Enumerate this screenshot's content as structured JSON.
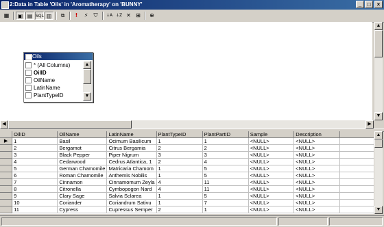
{
  "window": {
    "title": "2:Data in Table 'Oils' in 'Aromatherapy' on 'BUNNY'",
    "controls": [
      "_",
      "□",
      "×"
    ]
  },
  "toolbar": {
    "buttons": [
      {
        "name": "new-query-icon",
        "glyph": "▦"
      },
      {
        "name": "show-diagram-pane-icon",
        "glyph": "▣"
      },
      {
        "name": "show-grid-pane-icon",
        "glyph": "▤"
      },
      {
        "name": "show-sql-pane-icon",
        "glyph": "SQL"
      },
      {
        "name": "show-results-pane-icon",
        "glyph": "▥"
      },
      {
        "name": "change-query-type-icon",
        "glyph": "⧉"
      },
      {
        "name": "run-icon",
        "glyph": "!"
      },
      {
        "name": "verify-sql-icon",
        "glyph": "⚡"
      },
      {
        "name": "filter-icon",
        "glyph": "⛉"
      },
      {
        "name": "sort-ascending-icon",
        "glyph": "↓A"
      },
      {
        "name": "sort-descending-icon",
        "glyph": "↓Z"
      },
      {
        "name": "remove-filter-icon",
        "glyph": "✕"
      },
      {
        "name": "group-by-icon",
        "glyph": "⊞"
      },
      {
        "name": "add-table-icon",
        "glyph": "⊕"
      }
    ]
  },
  "diagram": {
    "table_title": "Oils",
    "columns": [
      {
        "label": "* (All Columns)",
        "checked": false,
        "bold": false
      },
      {
        "label": "OilID",
        "checked": false,
        "bold": true
      },
      {
        "label": "OilName",
        "checked": false,
        "bold": false
      },
      {
        "label": "LatinName",
        "checked": false,
        "bold": false
      },
      {
        "label": "PlantTypeID",
        "checked": false,
        "bold": false
      }
    ]
  },
  "grid": {
    "headers": [
      "OilID",
      "OilName",
      "LatinName",
      "PlantTypeID",
      "PlantPartID",
      "Sample",
      "Description"
    ],
    "rows": [
      [
        "1",
        "Basil",
        "Ocimum Basilicum",
        "1",
        "1",
        "<NULL>",
        "<NULL>"
      ],
      [
        "2",
        "Bergamot",
        "Citrus Bergamia",
        "2",
        "2",
        "<NULL>",
        "<NULL>"
      ],
      [
        "3",
        "Black Pepper",
        "Piper Nigrum",
        "3",
        "3",
        "<NULL>",
        "<NULL>"
      ],
      [
        "4",
        "Cedarwood",
        "Cedrus Atlantica, 1",
        "2",
        "4",
        "<NULL>",
        "<NULL>"
      ],
      [
        "5",
        "German Chamomile",
        "Matricaria Chamom",
        "1",
        "5",
        "<NULL>",
        "<NULL>"
      ],
      [
        "6",
        "Roman Chamomile",
        "Anthemis Nobilis",
        "1",
        "5",
        "<NULL>",
        "<NULL>"
      ],
      [
        "7",
        "Cinnamon",
        "Cinnamomum Zeyla",
        "4",
        "11",
        "<NULL>",
        "<NULL>"
      ],
      [
        "8",
        "Citronella",
        "Cymbopogon Nard",
        "4",
        "11",
        "<NULL>",
        "<NULL>"
      ],
      [
        "9",
        "Clary Sage",
        "Salvia Sclarea",
        "1",
        "5",
        "<NULL>",
        "<NULL>"
      ],
      [
        "10",
        "Coriander",
        "Coriandrum Sativu",
        "1",
        "7",
        "<NULL>",
        "<NULL>"
      ],
      [
        "11",
        "Cypress",
        "Cupressus Semper",
        "2",
        "1",
        "<NULL>",
        "<NULL>"
      ]
    ],
    "current_row_marker": "▶"
  },
  "colors": {
    "title_bar": "#0a246a",
    "face": "#d4d0c8",
    "window": "#ffffff"
  }
}
